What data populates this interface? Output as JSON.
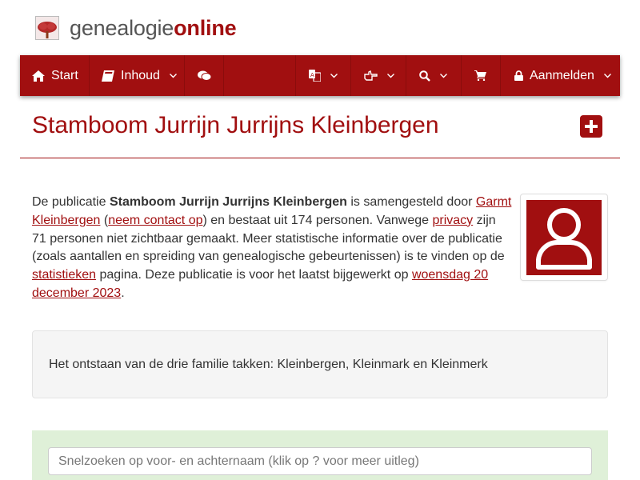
{
  "brand": {
    "part1": "genealogie",
    "part2": "online",
    "logo_icon": "tree-icon"
  },
  "nav": {
    "start_label": "Start",
    "inhoud_label": "Inhoud",
    "login_label": "Aanmelden",
    "icons": [
      "home-icon",
      "book-icon",
      "comments-icon",
      "translate-icon",
      "hand-pointer-icon",
      "search-icon",
      "cart-icon",
      "lock-icon"
    ]
  },
  "page": {
    "title": "Stamboom Jurrijn Jurrijns Kleinbergen"
  },
  "intro": {
    "t1": "De publicatie ",
    "pub_name": "Stamboom Jurrijn Jurrijns Kleinbergen",
    "t2": " is samengesteld door ",
    "author_link": "Garmt Kleinbergen",
    "t3": " (",
    "contact_link": "neem contact op",
    "t4": ") en bestaat uit 174 personen. Vanwege ",
    "privacy_link": "privacy",
    "t5": " zijn 71 personen niet zichtbaar gemaakt. Meer statistische informatie over de publicatie (zoals aantallen en spreiding van genealogische gebeurtenissen) is te vinden op de ",
    "stats_link": "statistieken",
    "t6": " pagina. Deze publicatie is voor het laatst bijgewerkt op ",
    "date_link": "woensdag 20 december 2023",
    "t7": "."
  },
  "description": "Het ontstaan van de drie familie takken: Kleinbergen, Kleinmark en Kleinmerk",
  "search": {
    "placeholder": "Snelzoeken op voor- en achternaam (klik op ? voor meer uitleg)"
  },
  "colors": {
    "accent": "#a10f10",
    "search_bg": "#dff0d8",
    "well_bg": "#f5f5f5"
  }
}
